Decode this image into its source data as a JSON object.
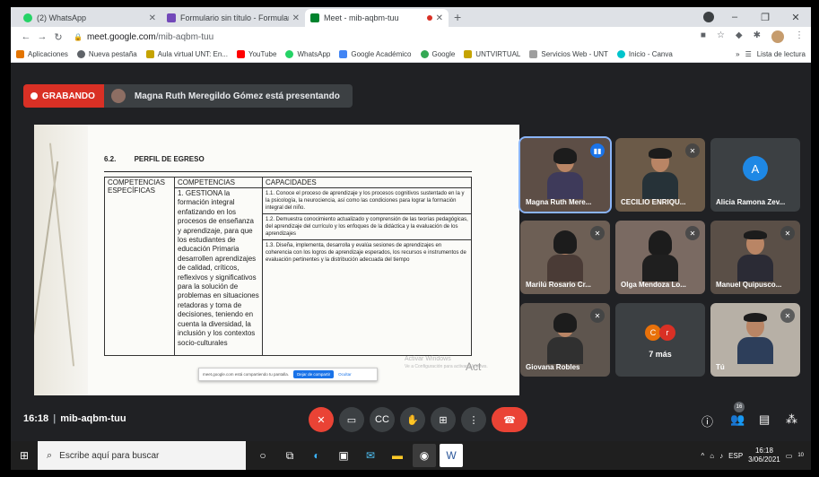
{
  "browser": {
    "tabs": [
      {
        "label": "(2) WhatsApp",
        "favicon_color": "#25d366",
        "active": false,
        "recording": false
      },
      {
        "label": "Formulario sin título - Formulario",
        "favicon_color": "#7248b9",
        "active": false,
        "recording": false
      },
      {
        "label": "Meet - mib-aqbm-tuu",
        "favicon_color": "#00832d",
        "active": true,
        "recording": true
      }
    ],
    "new_tab": "+",
    "window_controls": [
      "–",
      "❐",
      "✕"
    ],
    "address": {
      "host": "meet.google.com",
      "path": "/mib-aqbm-tuu"
    },
    "bookmarks": [
      {
        "label": "Aplicaciones",
        "color": "#e37400"
      },
      {
        "label": "Nueva pestaña",
        "color": "#5f6368"
      },
      {
        "label": "Aula virtual UNT: En...",
        "color": "#c5a300"
      },
      {
        "label": "YouTube",
        "color": "#ff0000"
      },
      {
        "label": "WhatsApp",
        "color": "#25d366"
      },
      {
        "label": "Google Académico",
        "color": "#4285f4"
      },
      {
        "label": "Google",
        "color": "#34a853"
      },
      {
        "label": "UNTVIRTUAL",
        "color": "#c5a300"
      },
      {
        "label": "Servicios Web - UNT",
        "color": "#9e9e9e"
      },
      {
        "label": "Inicio - Canva",
        "color": "#00c4cc"
      }
    ],
    "bookmarks_more": "»",
    "reading_list": "Lista de lectura"
  },
  "meet": {
    "recording_label": "GRABANDO",
    "presenting_text": "Magna Ruth Meregildo Gómez está presentando",
    "time": "16:18",
    "meeting_code": "mib-aqbm-tuu",
    "participant_count": "16",
    "more_label": "7 más",
    "participants": [
      {
        "name": "Magna Ruth Mere...",
        "state": "speaking"
      },
      {
        "name": "CECILIO ENRIQU...",
        "state": "muted"
      },
      {
        "name": "Alicia Ramona Zev...",
        "state": "avatar",
        "initial": "A"
      },
      {
        "name": "Marilú Rosario Cr...",
        "state": "muted"
      },
      {
        "name": "Olga Mendoza Lo...",
        "state": "muted"
      },
      {
        "name": "Manuel Quipusco...",
        "state": "muted"
      },
      {
        "name": "Giovana Robles",
        "state": "muted"
      },
      {
        "name": "Tú",
        "state": "muted"
      }
    ],
    "more_avatars": [
      {
        "letter": "C",
        "color": "#e8710a"
      },
      {
        "letter": "r",
        "color": "#d93025"
      }
    ]
  },
  "document": {
    "section_number": "6.2.",
    "section_title": "PERFIL DE EGRESO",
    "table": {
      "headers": [
        "COMPETENCIAS",
        "CAPACIDADES"
      ],
      "row_label": "COMPETENCIAS ESPECÍFICAS",
      "competency": "1. GESTIONA la formación integral enfatizando en los procesos de enseñanza y aprendizaje, para que los estudiantes de educación Primaria desarrollen aprendizajes de calidad, críticos, reflexivos y significativos para la solución de problemas en situaciones retadoras y toma de decisiones, teniendo en cuenta la diversidad, la inclusión y los contextos socio-culturales",
      "capacities": [
        "1.1. Conoce el proceso de aprendizaje y los procesos cognitivos sustentado en la y la psicología, la neurociencia, así como las condiciones para lograr la formación integral del niño.",
        "1.2. Demuestra conocimiento actualizado y comprensión de las teorías pedagógicas, del aprendizaje del currículo y los enfoques de la didáctica y la evaluación de los aprendizajes",
        "1.3. Diseña, implementa, desarrolla y evalúa sesiones de aprendizajes en coherencia con los logros de aprendizaje esperados, los recursos e instrumentos de evaluación pertinentes y la distribución adecuada del tiempo"
      ]
    },
    "share_bar": {
      "text": "meet.google.com está compartiendo tu pantalla.",
      "stop": "Dejar de compartir",
      "hide": "Ocultar"
    },
    "watermark": {
      "line1": "Activar Windows",
      "line2": "Ve a Configuración para activar Windows.",
      "big": "Act"
    }
  },
  "taskbar": {
    "search_placeholder": "Escribe aquí para buscar",
    "language": "ESP",
    "time": "16:18",
    "date": "3/06/2021",
    "notif_count": "10"
  },
  "colors": {
    "meet_bg": "#202124",
    "tile_bg": "#3c4043",
    "record_red": "#d93025",
    "hangup_red": "#ea4335",
    "accent_blue": "#1a73e8"
  }
}
